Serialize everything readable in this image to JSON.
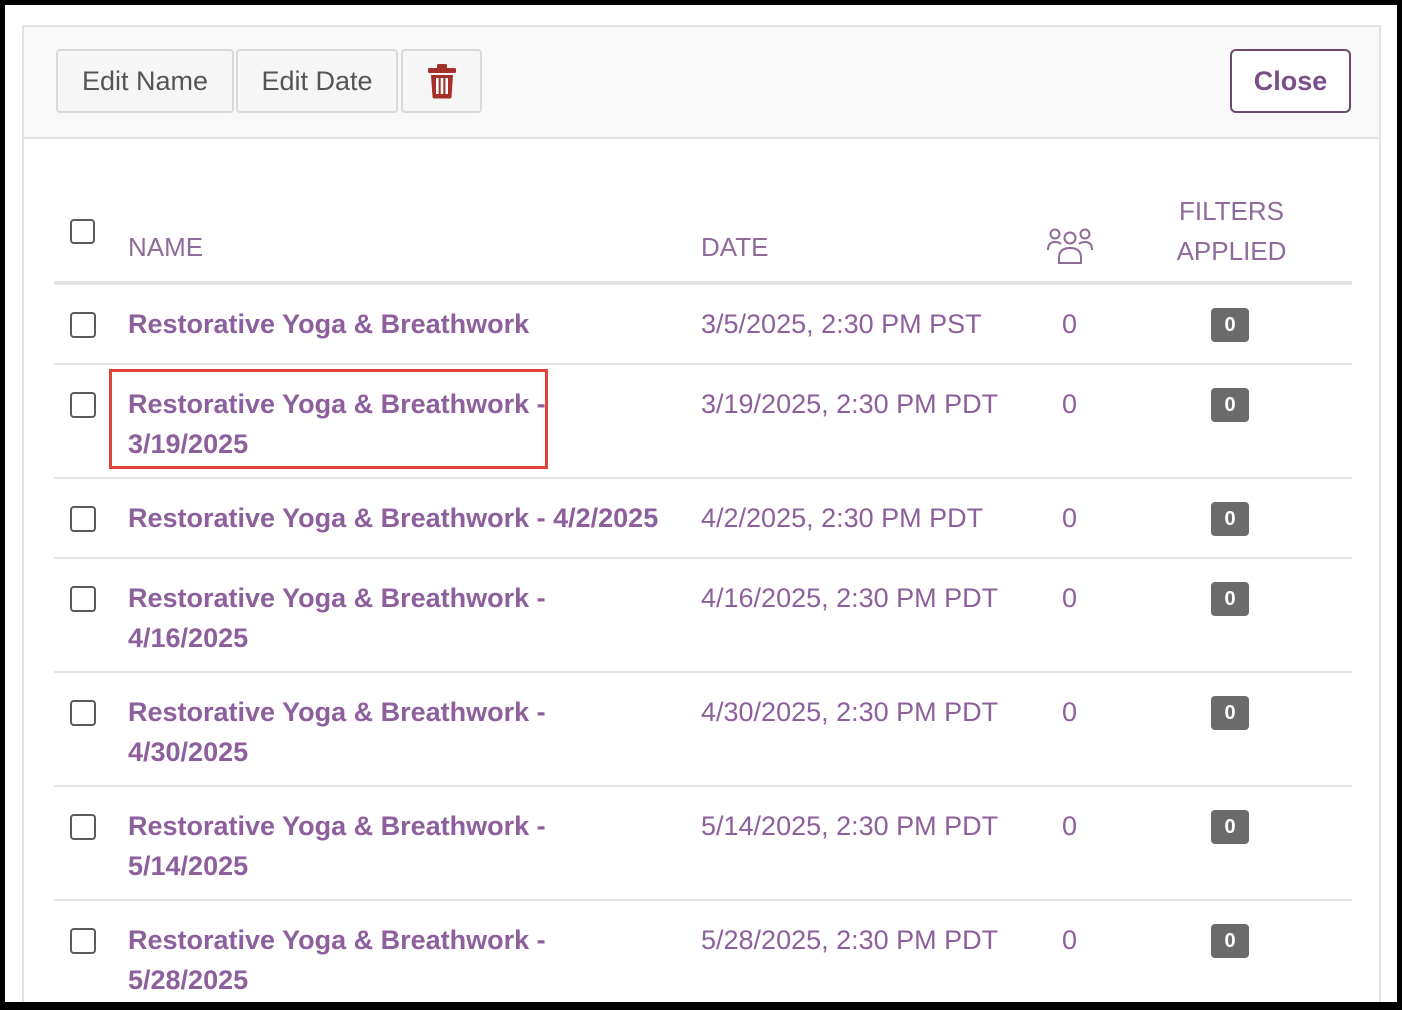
{
  "toolbar": {
    "edit_name_label": "Edit Name",
    "edit_date_label": "Edit Date",
    "delete_icon": "trash-icon",
    "close_label": "Close"
  },
  "table": {
    "headers": {
      "name": "NAME",
      "date": "DATE",
      "attendees_icon": "people-icon",
      "filters_line1": "FILTERS",
      "filters_line2": "APPLIED"
    },
    "rows": [
      {
        "name": "Restorative Yoga & Breathwork",
        "date": "3/5/2025, 2:30 PM PST",
        "count": "0",
        "filters": "0"
      },
      {
        "name": "Restorative Yoga & Breathwork - 3/19/2025",
        "date": "3/19/2025, 2:30 PM PDT",
        "count": "0",
        "filters": "0"
      },
      {
        "name": "Restorative Yoga & Breathwork - 4/2/2025",
        "date": "4/2/2025, 2:30 PM PDT",
        "count": "0",
        "filters": "0"
      },
      {
        "name": "Restorative Yoga & Breathwork - 4/16/2025",
        "date": "4/16/2025, 2:30 PM PDT",
        "count": "0",
        "filters": "0"
      },
      {
        "name": "Restorative Yoga & Breathwork - 4/30/2025",
        "date": "4/30/2025, 2:30 PM PDT",
        "count": "0",
        "filters": "0"
      },
      {
        "name": "Restorative Yoga & Breathwork - 5/14/2025",
        "date": "5/14/2025, 2:30 PM PDT",
        "count": "0",
        "filters": "0"
      },
      {
        "name": "Restorative Yoga & Breathwork - 5/28/2025",
        "date": "5/28/2025, 2:30 PM PDT",
        "count": "0",
        "filters": "0"
      }
    ]
  },
  "colors": {
    "accent": "#8d5f9c",
    "badge": "#6b6b6b",
    "delete": "#a5302a",
    "highlight": "#e0453a"
  }
}
